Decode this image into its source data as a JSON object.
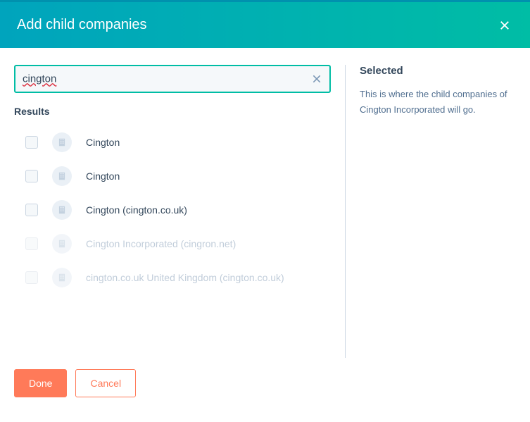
{
  "header": {
    "title": "Add child companies"
  },
  "search": {
    "value": "cington"
  },
  "results": {
    "label": "Results",
    "items": [
      {
        "name": "Cington",
        "disabled": false
      },
      {
        "name": "Cington",
        "disabled": false
      },
      {
        "name": "Cington (cington.co.uk)",
        "disabled": false
      },
      {
        "name": "Cington Incorporated (cingron.net)",
        "disabled": true
      },
      {
        "name": "cington.co.uk United Kingdom (cington.co.uk)",
        "disabled": true
      }
    ]
  },
  "selected": {
    "heading": "Selected",
    "text": "This is where the child companies of Cington Incorporated will go."
  },
  "footer": {
    "done": "Done",
    "cancel": "Cancel"
  }
}
